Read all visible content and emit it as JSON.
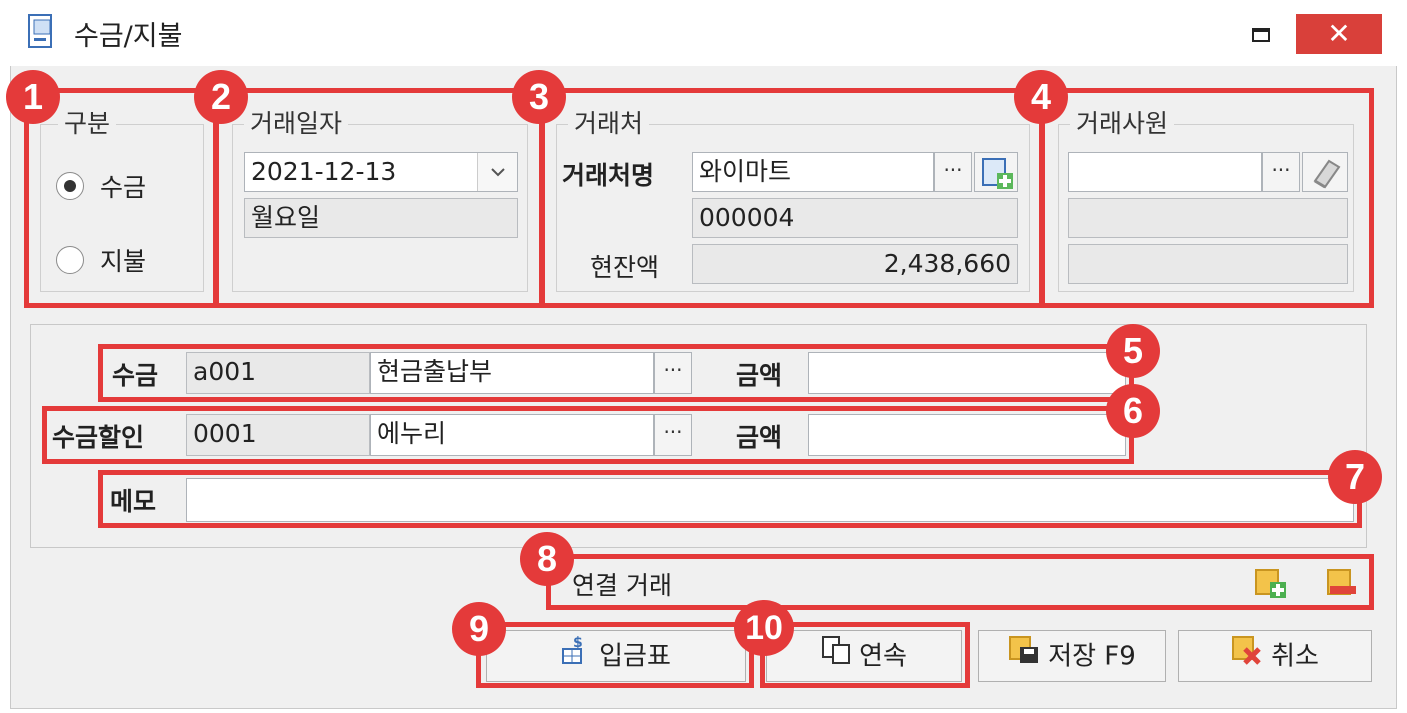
{
  "window": {
    "title": "수금/지불",
    "close_label": "✕"
  },
  "groups": {
    "type": {
      "label": "구분",
      "options": [
        "수금",
        "지불"
      ],
      "selected": "수금"
    },
    "date": {
      "label": "거래일자",
      "value": "2021-12-13",
      "weekday": "월요일"
    },
    "customer": {
      "label": "거래처",
      "name_label": "거래처명",
      "name_value": "와이마트",
      "code": "000004",
      "balance_label": "현잔액",
      "balance_value": "2,438,660"
    },
    "employee": {
      "label": "거래사원",
      "value": ""
    }
  },
  "rows": {
    "payment": {
      "label": "수금",
      "code": "a001",
      "name": "현금출납부",
      "amount_label": "금액",
      "amount": ""
    },
    "discount": {
      "label": "수금할인",
      "code": "0001",
      "name": "에누리",
      "amount_label": "금액",
      "amount": ""
    },
    "memo": {
      "label": "메모",
      "value": ""
    }
  },
  "linked": {
    "label": "연결 거래"
  },
  "buttons": {
    "receipt": "입금표",
    "continue": "연속",
    "save": "저장 F9",
    "cancel": "취소",
    "ellipsis": "···"
  },
  "badges": [
    "1",
    "2",
    "3",
    "4",
    "5",
    "6",
    "7",
    "8",
    "9",
    "10"
  ],
  "colors": {
    "accent_red": "#e43a3a",
    "close_bg": "#d9403a"
  }
}
